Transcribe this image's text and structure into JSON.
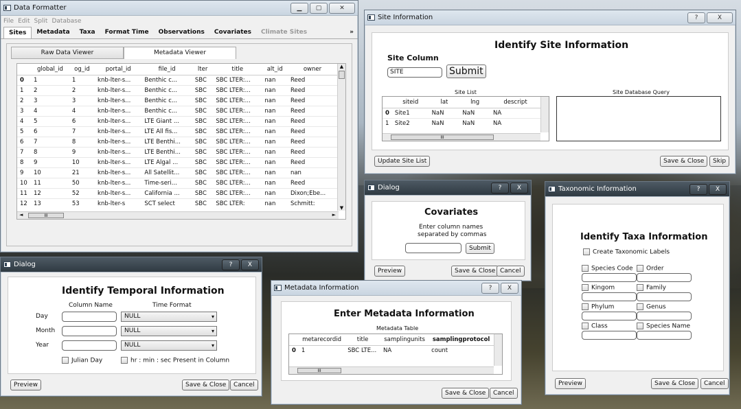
{
  "data_formatter": {
    "title": "Data Formatter",
    "menu": [
      "File",
      "Edit",
      "Split",
      "Database"
    ],
    "tabs": [
      "Sites",
      "Metadata",
      "Taxa",
      "Format Time",
      "Observations",
      "Covariates",
      "Climate Sites"
    ],
    "tab_more": "»",
    "subtabs": [
      "Raw Data Viewer",
      "Metadata Viewer"
    ],
    "columns": [
      "",
      "global_id",
      "og_id",
      "portal_id",
      "file_id",
      "lter",
      "title",
      "alt_id",
      "owner"
    ],
    "rows": [
      [
        "0",
        "1",
        "1",
        "knb-lter-s...",
        "Benthic c...",
        "SBC",
        "SBC LTER:...",
        "nan",
        "Reed"
      ],
      [
        "1",
        "2",
        "2",
        "knb-lter-s...",
        "Benthic c...",
        "SBC",
        "SBC LTER:...",
        "nan",
        "Reed"
      ],
      [
        "2",
        "3",
        "3",
        "knb-lter-s...",
        "Benthic c...",
        "SBC",
        "SBC LTER:...",
        "nan",
        "Reed"
      ],
      [
        "3",
        "4",
        "4",
        "knb-lter-s...",
        "Benthic c...",
        "SBC",
        "SBC LTER:...",
        "nan",
        "Reed"
      ],
      [
        "4",
        "5",
        "6",
        "knb-lter-s...",
        "LTE Giant ...",
        "SBC",
        "SBC LTER:...",
        "nan",
        "Reed"
      ],
      [
        "5",
        "6",
        "7",
        "knb-lter-s...",
        "LTE All fis...",
        "SBC",
        "SBC LTER:...",
        "nan",
        "Reed"
      ],
      [
        "6",
        "7",
        "8",
        "knb-lter-s...",
        "LTE Benthi...",
        "SBC",
        "SBC LTER:...",
        "nan",
        "Reed"
      ],
      [
        "7",
        "8",
        "9",
        "knb-lter-s...",
        "LTE Benthi...",
        "SBC",
        "SBC LTER:...",
        "nan",
        "Reed"
      ],
      [
        "8",
        "9",
        "10",
        "knb-lter-s...",
        "LTE Algal ...",
        "SBC",
        "SBC LTER:...",
        "nan",
        "Reed"
      ],
      [
        "9",
        "10",
        "21",
        "knb-lter-s...",
        "All Satellit...",
        "SBC",
        "SBC LTER:...",
        "nan",
        "nan"
      ],
      [
        "10",
        "11",
        "50",
        "knb-lter-s...",
        "Time-seri...",
        "SBC",
        "SBC LTER:...",
        "nan",
        "Reed"
      ],
      [
        "11",
        "12",
        "52",
        "knb-lter-s...",
        "California ...",
        "SBC",
        "SBC LTER:...",
        "nan",
        "Dixon;Ebe..."
      ],
      [
        "12",
        "13",
        "53",
        "knb-lter-s",
        "SCT select",
        "SBC",
        "SBC LTER:",
        "nan",
        "Schmitt:"
      ]
    ],
    "hscroll_thumb": "III"
  },
  "site_info": {
    "title": "Site Information",
    "heading": "Identify Site Information",
    "site_column_label": "Site Column",
    "site_input": "SITE",
    "submit": "Submit",
    "site_list_label": "Site List",
    "site_db_label": "Site Database Query",
    "columns": [
      "",
      "siteid",
      "lat",
      "lng",
      "descript"
    ],
    "rows": [
      [
        "0",
        "Site1",
        "NaN",
        "NaN",
        "NA"
      ],
      [
        "1",
        "Site2",
        "NaN",
        "NaN",
        "NA"
      ]
    ],
    "hscroll_thumb": "III",
    "update_btn": "Update Site List",
    "save_close": "Save & Close",
    "skip": "Skip"
  },
  "covariates": {
    "title": "Dialog",
    "heading": "Covariates",
    "instruction_1": "Enter column names",
    "instruction_2": "separated by commas",
    "submit": "Submit",
    "preview": "Preview",
    "save_close": "Save & Close",
    "cancel": "Cancel"
  },
  "taxonomic": {
    "title": "Taxonomic Information",
    "heading": "Identify Taxa Information",
    "create_labels": "Create Taxonomic Labels",
    "fields": [
      "Species Code",
      "Order",
      "Kingom",
      "Family",
      "Phylum",
      "Genus",
      "Class",
      "Species Name"
    ],
    "preview": "Preview",
    "save_close": "Save & Close",
    "cancel": "Cancel"
  },
  "temporal": {
    "title": "Dialog",
    "heading": "Identify Temporal Information",
    "col_name_label": "Column Name",
    "time_format_label": "Time Format",
    "rows": [
      {
        "label": "Day",
        "format": "NULL"
      },
      {
        "label": "Month",
        "format": "NULL"
      },
      {
        "label": "Year",
        "format": "NULL"
      }
    ],
    "julian": "Julian Day",
    "hms": "hr : min : sec Present in Column",
    "preview": "Preview",
    "save_close": "Save & Close",
    "cancel": "Cancel"
  },
  "metadata_info": {
    "title": "Metadata Information",
    "heading": "Enter Metadata Information",
    "table_label": "Metadata Table",
    "columns": [
      "",
      "metarecordid",
      "title",
      "samplingunits",
      "samplingprotocol"
    ],
    "rows": [
      [
        "0",
        "1",
        "SBC LTE...",
        "NA",
        "count"
      ]
    ],
    "hscroll_thumb": "III",
    "save_close": "Save & Close",
    "cancel": "Cancel"
  },
  "icons": {
    "help": "?",
    "close": "X",
    "minimize": "_",
    "maximize": "□"
  }
}
